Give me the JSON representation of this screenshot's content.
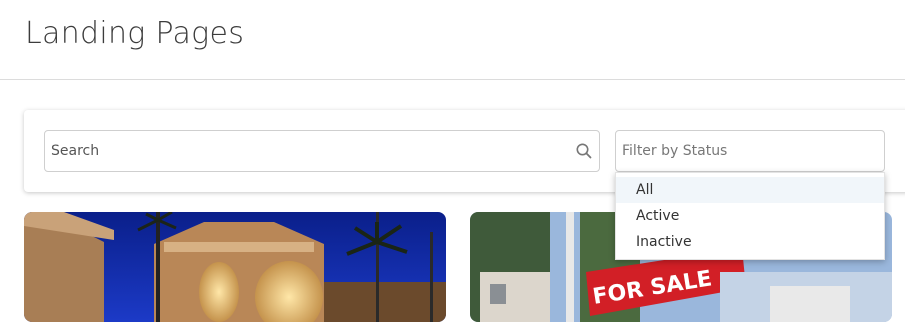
{
  "page": {
    "title": "Landing Pages"
  },
  "filters": {
    "search_placeholder": "Search",
    "status_placeholder": "Filter by Status",
    "status_options": [
      "All",
      "Active",
      "Inactive"
    ]
  },
  "cards": [
    {
      "image": "luxury-house-night-photo"
    },
    {
      "image": "for-sale-sign-photo",
      "sign_text": "FOR SALE"
    }
  ]
}
